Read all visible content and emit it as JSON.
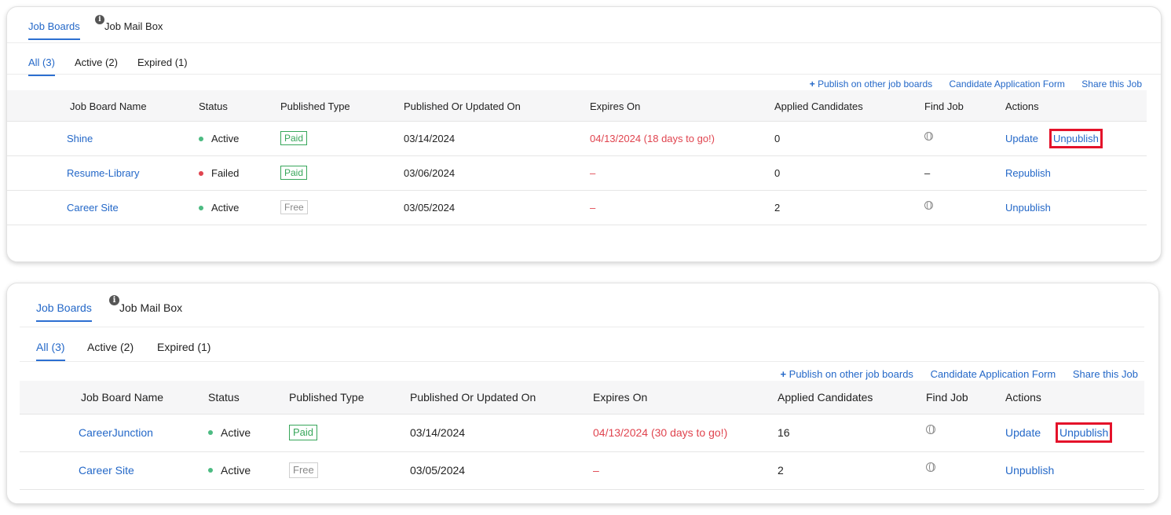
{
  "panels": [
    {
      "tabs": {
        "job_boards": "Job Boards",
        "job_mail_box": "Job Mail Box"
      },
      "filters": {
        "all": "All (3)",
        "active": "Active (2)",
        "expired": "Expired (1)"
      },
      "top_links": {
        "publish_plus": "+",
        "publish": "Publish on other job boards",
        "application_form": "Candidate Application Form",
        "share": "Share this Job"
      },
      "columns": [
        "Job Board Name",
        "Status",
        "Published Type",
        "Published Or Updated On",
        "Expires On",
        "Applied Candidates",
        "Find Job",
        "Actions"
      ],
      "rows": [
        {
          "name": "Shine",
          "status": "Active",
          "type": "Paid",
          "published_on": "03/14/2024",
          "expires_on": "04/13/2024 (18 days to go!)",
          "applied": "0",
          "find_job": "globe-icon",
          "action1": "Update",
          "action2": "Unpublish"
        },
        {
          "name": "Resume-Library",
          "status": "Failed",
          "type": "Paid",
          "published_on": "03/06/2024",
          "expires_on": "–",
          "applied": "0",
          "find_job": "–",
          "action1": "Republish",
          "action2": ""
        },
        {
          "name": "Career Site",
          "status": "Active",
          "type": "Free",
          "published_on": "03/05/2024",
          "expires_on": "–",
          "applied": "2",
          "find_job": "globe-icon",
          "action1": "Unpublish",
          "action2": ""
        }
      ]
    },
    {
      "tabs": {
        "job_boards": "Job Boards",
        "job_mail_box": "Job Mail Box"
      },
      "filters": {
        "all": "All (3)",
        "active": "Active (2)",
        "expired": "Expired (1)"
      },
      "top_links": {
        "publish_plus": "+",
        "publish": "Publish on other job boards",
        "application_form": "Candidate Application Form",
        "share": "Share this Job"
      },
      "columns": [
        "Job Board Name",
        "Status",
        "Published Type",
        "Published Or Updated On",
        "Expires On",
        "Applied Candidates",
        "Find Job",
        "Actions"
      ],
      "rows": [
        {
          "name": "CareerJunction",
          "status": "Active",
          "type": "Paid",
          "published_on": "03/14/2024",
          "expires_on": "04/13/2024 (30 days to go!)",
          "applied": "16",
          "find_job": "globe-icon",
          "action1": "Update",
          "action2": "Unpublish"
        },
        {
          "name": "Career Site",
          "status": "Active",
          "type": "Free",
          "published_on": "03/05/2024",
          "expires_on": "–",
          "applied": "2",
          "find_job": "globe-icon",
          "action1": "Unpublish",
          "action2": ""
        }
      ]
    }
  ],
  "info_icon_glyph": "i",
  "colors": {
    "link": "#2468c8",
    "active_dot": "#4cbb82",
    "failed_dot": "#e0444f",
    "expiry_red": "#e0444f",
    "highlight": "#e4122a"
  }
}
